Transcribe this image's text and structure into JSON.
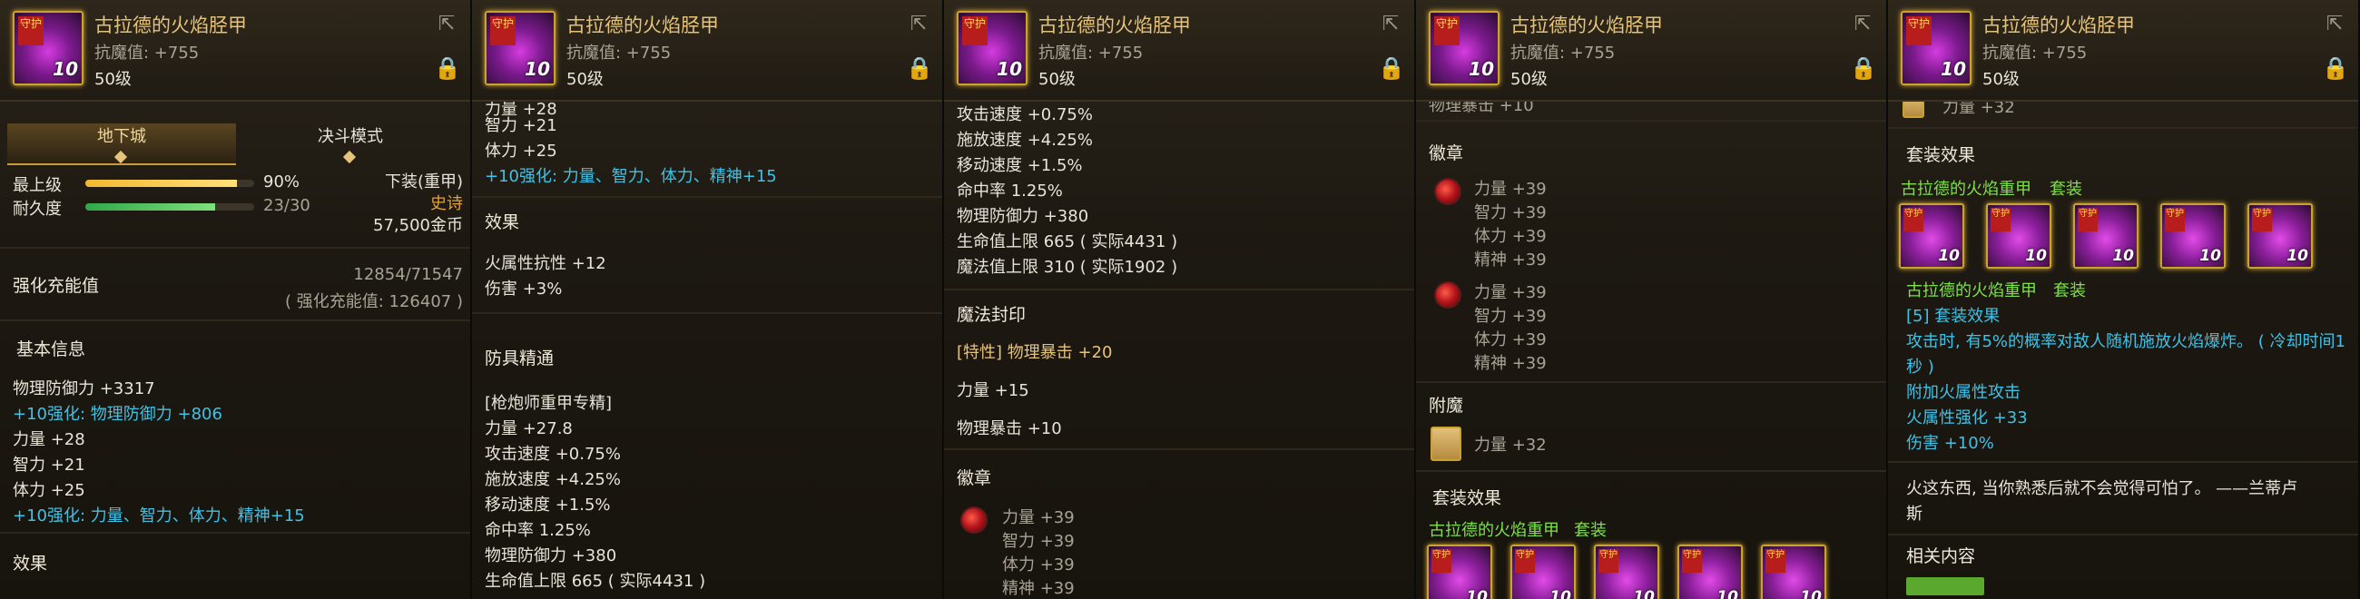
{
  "item": {
    "name": "古拉德的火焰胫甲",
    "resist": "抗魔值: +755",
    "level": "50级",
    "icon_level": "10",
    "ribbon_text": "守护"
  },
  "p1": {
    "tabs": [
      "地下城",
      "决斗模式"
    ],
    "top_label": "最上级",
    "top_pct": "90%",
    "top_fill": 0.9,
    "durability_label": "耐久度",
    "durability_value": "23/30",
    "durability_fill": 0.767,
    "slot_type": "下装(重甲)",
    "rarity": "史诗",
    "price": "57,500金币",
    "charge_label": "强化充能值",
    "charge_value": "12854/71547",
    "charge_sub": "( 强化充能值: 126407 )",
    "basic_title": "基本信息",
    "lines": [
      "物理防御力 +3317",
      "+10强化: 物理防御力 +806",
      "力量 +28",
      "智力 +21",
      "体力 +25",
      "+10强化: 力量、智力、体力、精神+15"
    ],
    "effect_title": "效果"
  },
  "p2": {
    "partial_top": "力量 +28",
    "lines": [
      "智力 +21",
      "体力 +25",
      "+10强化: 力量、智力、体力、精神+15"
    ],
    "effect_title": "效果",
    "effects": [
      "火属性抗性 +12",
      "伤害 +3%"
    ],
    "mastery_title": "防具精通",
    "mastery_lines": [
      "[枪炮师重甲专精]",
      "力量 +27.8",
      "攻击速度 +0.75%",
      "施放速度 +4.25%",
      "移动速度 +1.5%",
      "命中率 1.25%",
      "物理防御力 +380",
      "生命值上限 665 ( 实际4431 )"
    ]
  },
  "p3": {
    "lines": [
      "攻击速度 +0.75%",
      "施放速度 +4.25%",
      "移动速度 +1.5%",
      "命中率 1.25%",
      "物理防御力 +380",
      "生命值上限 665 ( 实际4431 )",
      "魔法值上限 310 ( 实际1902 )"
    ],
    "seal_title": "魔法封印",
    "seal_lines": [
      "[特性] 物理暴击 +20",
      "力量 +15",
      "物理暴击 +10"
    ],
    "emblem_title": "徽章",
    "emblem_lines": [
      "力量 +39",
      "智力 +39",
      "体力 +39",
      "精神 +39"
    ]
  },
  "p4": {
    "partial_top": "物理暴击 +10",
    "emblem_title": "徽章",
    "emblem1": [
      "力量 +39",
      "智力 +39",
      "体力 +39",
      "精神 +39"
    ],
    "emblem2": [
      "力量 +39",
      "智力 +39",
      "体力 +39",
      "精神 +39"
    ],
    "enchant_title": "附魔",
    "enchant_line": "力量 +32",
    "set_title": "套装效果",
    "set_name": "古拉德的火焰重甲",
    "set_tag": "套装"
  },
  "p5": {
    "partial_top": "力量 +32",
    "set_title": "套装效果",
    "set_name": "古拉德的火焰重甲",
    "set_tag": "套装",
    "set_sub_name": "古拉德的火焰重甲",
    "set_sub_tag": "套装",
    "set_effect": "[5] 套装效果",
    "set_desc1": "攻击时, 有5%的概率对敌人随机施放火焰爆炸。 ( 冷却时间1",
    "set_desc2": "秒 )",
    "set_extra": [
      "附加火属性攻击",
      "火属性强化 +33",
      "伤害 +10%"
    ],
    "quote1": "火这东西, 当你熟悉后就不会觉得可怕了。 ——兰蒂卢",
    "quote2": "斯",
    "related_title": "相关内容"
  },
  "colors": {
    "gold": "#e6c37a",
    "cyan": "#3fc2e6",
    "green": "#7ee04a",
    "orange": "#e0a23a"
  },
  "icons": [
    "share-icon",
    "lock-icon",
    "emblem-gem-icon",
    "enchant-card-icon",
    "set-item-icon"
  ]
}
